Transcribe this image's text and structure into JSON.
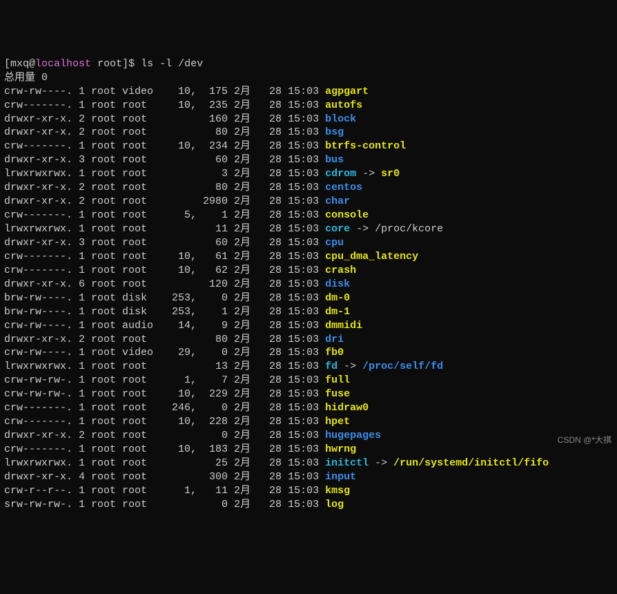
{
  "prompt": {
    "user": "mxq",
    "at": "@",
    "host": "localhost",
    "path": "root",
    "dollar": "$",
    "command": "ls",
    "args": "-l /dev"
  },
  "header": "总用量 0",
  "watermark": "CSDN @*大祺",
  "rows": [
    {
      "perm": "crw-rw----.",
      "links": "1",
      "owner": "root",
      "group": "video",
      "major": "10,",
      "minor": "175",
      "month": "2月",
      "day": "28",
      "time": "15:03",
      "name": "agpgart",
      "ntype": "special"
    },
    {
      "perm": "crw-------.",
      "links": "1",
      "owner": "root",
      "group": "root",
      "major": "10,",
      "minor": "235",
      "month": "2月",
      "day": "28",
      "time": "15:03",
      "name": "autofs",
      "ntype": "special"
    },
    {
      "perm": "drwxr-xr-x.",
      "links": "2",
      "owner": "root",
      "group": "root",
      "major": "",
      "minor": "160",
      "month": "2月",
      "day": "28",
      "time": "15:03",
      "name": "block",
      "ntype": "dir"
    },
    {
      "perm": "drwxr-xr-x.",
      "links": "2",
      "owner": "root",
      "group": "root",
      "major": "",
      "minor": "80",
      "month": "2月",
      "day": "28",
      "time": "15:03",
      "name": "bsg",
      "ntype": "dir"
    },
    {
      "perm": "crw-------.",
      "links": "1",
      "owner": "root",
      "group": "root",
      "major": "10,",
      "minor": "234",
      "month": "2月",
      "day": "28",
      "time": "15:03",
      "name": "btrfs-control",
      "ntype": "special"
    },
    {
      "perm": "drwxr-xr-x.",
      "links": "3",
      "owner": "root",
      "group": "root",
      "major": "",
      "minor": "60",
      "month": "2月",
      "day": "28",
      "time": "15:03",
      "name": "bus",
      "ntype": "dir"
    },
    {
      "perm": "lrwxrwxrwx.",
      "links": "1",
      "owner": "root",
      "group": "root",
      "major": "",
      "minor": "3",
      "month": "2月",
      "day": "28",
      "time": "15:03",
      "name": "cdrom",
      "ntype": "link",
      "arrow": " -> ",
      "target": "sr0",
      "ttype": "special"
    },
    {
      "perm": "drwxr-xr-x.",
      "links": "2",
      "owner": "root",
      "group": "root",
      "major": "",
      "minor": "80",
      "month": "2月",
      "day": "28",
      "time": "15:03",
      "name": "centos",
      "ntype": "dir"
    },
    {
      "perm": "drwxr-xr-x.",
      "links": "2",
      "owner": "root",
      "group": "root",
      "major": "",
      "minor": "2980",
      "month": "2月",
      "day": "28",
      "time": "15:03",
      "name": "char",
      "ntype": "dir"
    },
    {
      "perm": "crw-------.",
      "links": "1",
      "owner": "root",
      "group": "root",
      "major": "5,",
      "minor": "1",
      "month": "2月",
      "day": "28",
      "time": "15:03",
      "name": "console",
      "ntype": "special"
    },
    {
      "perm": "lrwxrwxrwx.",
      "links": "1",
      "owner": "root",
      "group": "root",
      "major": "",
      "minor": "11",
      "month": "2月",
      "day": "28",
      "time": "15:03",
      "name": "core",
      "ntype": "link",
      "arrow": " -> ",
      "target": "/proc/kcore",
      "ttype": "plain"
    },
    {
      "perm": "drwxr-xr-x.",
      "links": "3",
      "owner": "root",
      "group": "root",
      "major": "",
      "minor": "60",
      "month": "2月",
      "day": "28",
      "time": "15:03",
      "name": "cpu",
      "ntype": "dir"
    },
    {
      "perm": "crw-------.",
      "links": "1",
      "owner": "root",
      "group": "root",
      "major": "10,",
      "minor": "61",
      "month": "2月",
      "day": "28",
      "time": "15:03",
      "name": "cpu_dma_latency",
      "ntype": "special"
    },
    {
      "perm": "crw-------.",
      "links": "1",
      "owner": "root",
      "group": "root",
      "major": "10,",
      "minor": "62",
      "month": "2月",
      "day": "28",
      "time": "15:03",
      "name": "crash",
      "ntype": "special"
    },
    {
      "perm": "drwxr-xr-x.",
      "links": "6",
      "owner": "root",
      "group": "root",
      "major": "",
      "minor": "120",
      "month": "2月",
      "day": "28",
      "time": "15:03",
      "name": "disk",
      "ntype": "dir"
    },
    {
      "perm": "brw-rw----.",
      "links": "1",
      "owner": "root",
      "group": "disk",
      "major": "253,",
      "minor": "0",
      "month": "2月",
      "day": "28",
      "time": "15:03",
      "name": "dm-0",
      "ntype": "special"
    },
    {
      "perm": "brw-rw----.",
      "links": "1",
      "owner": "root",
      "group": "disk",
      "major": "253,",
      "minor": "1",
      "month": "2月",
      "day": "28",
      "time": "15:03",
      "name": "dm-1",
      "ntype": "special"
    },
    {
      "perm": "crw-rw----.",
      "links": "1",
      "owner": "root",
      "group": "audio",
      "major": "14,",
      "minor": "9",
      "month": "2月",
      "day": "28",
      "time": "15:03",
      "name": "dmmidi",
      "ntype": "special"
    },
    {
      "perm": "drwxr-xr-x.",
      "links": "2",
      "owner": "root",
      "group": "root",
      "major": "",
      "minor": "80",
      "month": "2月",
      "day": "28",
      "time": "15:03",
      "name": "dri",
      "ntype": "dir"
    },
    {
      "perm": "crw-rw----.",
      "links": "1",
      "owner": "root",
      "group": "video",
      "major": "29,",
      "minor": "0",
      "month": "2月",
      "day": "28",
      "time": "15:03",
      "name": "fb0",
      "ntype": "special"
    },
    {
      "perm": "lrwxrwxrwx.",
      "links": "1",
      "owner": "root",
      "group": "root",
      "major": "",
      "minor": "13",
      "month": "2月",
      "day": "28",
      "time": "15:03",
      "name": "fd",
      "ntype": "link",
      "arrow": " -> ",
      "target": "/proc/self/fd",
      "ttype": "dir"
    },
    {
      "perm": "crw-rw-rw-.",
      "links": "1",
      "owner": "root",
      "group": "root",
      "major": "1,",
      "minor": "7",
      "month": "2月",
      "day": "28",
      "time": "15:03",
      "name": "full",
      "ntype": "special"
    },
    {
      "perm": "crw-rw-rw-.",
      "links": "1",
      "owner": "root",
      "group": "root",
      "major": "10,",
      "minor": "229",
      "month": "2月",
      "day": "28",
      "time": "15:03",
      "name": "fuse",
      "ntype": "special"
    },
    {
      "perm": "crw-------.",
      "links": "1",
      "owner": "root",
      "group": "root",
      "major": "246,",
      "minor": "0",
      "month": "2月",
      "day": "28",
      "time": "15:03",
      "name": "hidraw0",
      "ntype": "special"
    },
    {
      "perm": "crw-------.",
      "links": "1",
      "owner": "root",
      "group": "root",
      "major": "10,",
      "minor": "228",
      "month": "2月",
      "day": "28",
      "time": "15:03",
      "name": "hpet",
      "ntype": "special"
    },
    {
      "perm": "drwxr-xr-x.",
      "links": "2",
      "owner": "root",
      "group": "root",
      "major": "",
      "minor": "0",
      "month": "2月",
      "day": "28",
      "time": "15:03",
      "name": "hugepages",
      "ntype": "dir"
    },
    {
      "perm": "crw-------.",
      "links": "1",
      "owner": "root",
      "group": "root",
      "major": "10,",
      "minor": "183",
      "month": "2月",
      "day": "28",
      "time": "15:03",
      "name": "hwrng",
      "ntype": "special"
    },
    {
      "perm": "lrwxrwxrwx.",
      "links": "1",
      "owner": "root",
      "group": "root",
      "major": "",
      "minor": "25",
      "month": "2月",
      "day": "28",
      "time": "15:03",
      "name": "initctl",
      "ntype": "link",
      "arrow": " -> ",
      "target": "/run/systemd/initctl/fifo",
      "ttype": "special"
    },
    {
      "perm": "drwxr-xr-x.",
      "links": "4",
      "owner": "root",
      "group": "root",
      "major": "",
      "minor": "300",
      "month": "2月",
      "day": "28",
      "time": "15:03",
      "name": "input",
      "ntype": "dir"
    },
    {
      "perm": "crw-r--r--.",
      "links": "1",
      "owner": "root",
      "group": "root",
      "major": "1,",
      "minor": "11",
      "month": "2月",
      "day": "28",
      "time": "15:03",
      "name": "kmsg",
      "ntype": "special"
    },
    {
      "perm": "srw-rw-rw-.",
      "links": "1",
      "owner": "root",
      "group": "root",
      "major": "",
      "minor": "0",
      "month": "2月",
      "day": "28",
      "time": "15:03",
      "name": "log",
      "ntype": "special"
    }
  ]
}
